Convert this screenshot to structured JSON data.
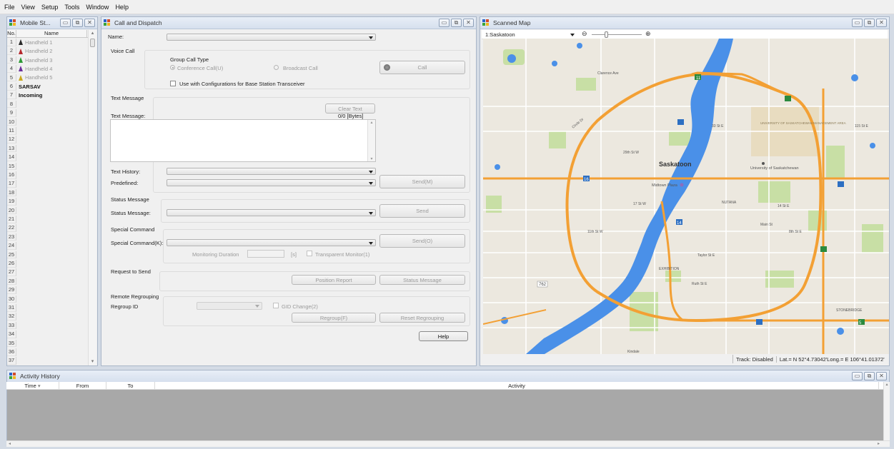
{
  "menu": [
    "File",
    "View",
    "Setup",
    "Tools",
    "Window",
    "Help"
  ],
  "mobile_stations": {
    "title": "Mobile St...",
    "col_no": "No.",
    "col_name": "Name",
    "rows": [
      {
        "no": "1",
        "name": "Handheld 1",
        "icon_color": "#2b2b2b",
        "bold": false
      },
      {
        "no": "2",
        "name": "Handheld 2",
        "icon_color": "#b5282d",
        "bold": false
      },
      {
        "no": "3",
        "name": "Handheld 3",
        "icon_color": "#2b9a34",
        "bold": false
      },
      {
        "no": "4",
        "name": "Handheld 4",
        "icon_color": "#6b2f9a",
        "bold": false
      },
      {
        "no": "5",
        "name": "Handheld 5",
        "icon_color": "#c9a81e",
        "bold": false
      },
      {
        "no": "6",
        "name": "SARSAV",
        "icon_color": "",
        "bold": true
      },
      {
        "no": "7",
        "name": "Incoming",
        "icon_color": "",
        "bold": true
      },
      {
        "no": "8",
        "name": ""
      },
      {
        "no": "9",
        "name": ""
      },
      {
        "no": "10",
        "name": ""
      },
      {
        "no": "11",
        "name": ""
      },
      {
        "no": "12",
        "name": ""
      },
      {
        "no": "13",
        "name": ""
      },
      {
        "no": "14",
        "name": ""
      },
      {
        "no": "15",
        "name": ""
      },
      {
        "no": "16",
        "name": ""
      },
      {
        "no": "17",
        "name": ""
      },
      {
        "no": "18",
        "name": ""
      },
      {
        "no": "19",
        "name": ""
      },
      {
        "no": "20",
        "name": ""
      },
      {
        "no": "21",
        "name": ""
      },
      {
        "no": "22",
        "name": ""
      },
      {
        "no": "23",
        "name": ""
      },
      {
        "no": "24",
        "name": ""
      },
      {
        "no": "25",
        "name": ""
      },
      {
        "no": "26",
        "name": ""
      },
      {
        "no": "27",
        "name": ""
      },
      {
        "no": "28",
        "name": ""
      },
      {
        "no": "29",
        "name": ""
      },
      {
        "no": "30",
        "name": ""
      },
      {
        "no": "31",
        "name": ""
      },
      {
        "no": "32",
        "name": ""
      },
      {
        "no": "33",
        "name": ""
      },
      {
        "no": "34",
        "name": ""
      },
      {
        "no": "35",
        "name": ""
      },
      {
        "no": "36",
        "name": ""
      },
      {
        "no": "37",
        "name": ""
      }
    ]
  },
  "call_dispatch": {
    "title": "Call and Dispatch",
    "name_label": "Name:",
    "voice_call": {
      "heading": "Voice Call",
      "group_call_type": "Group Call Type",
      "conference": "Conference Call(U)",
      "broadcast": "Broadcast Call",
      "call_button": "Call",
      "use_with_bst": "Use with Configurations for Base Station Transceiver"
    },
    "text_message": {
      "heading": "Text Message",
      "clear_button": "Clear Text",
      "label": "Text Message:",
      "bytes": "0/0 [Bytes]",
      "history_label": "Text History:",
      "predefined_label": "Predefined:",
      "send_button": "Send(M)"
    },
    "status_message": {
      "heading": "Status Message",
      "label": "Status Message:",
      "send_button": "Send"
    },
    "special_command": {
      "heading": "Special Command",
      "label": "Special Command(K):",
      "send_button": "Send(O)",
      "monitoring_label": "Monitoring Duration",
      "unit": "[s]",
      "transparent_label": "Transparent Monitor(1)"
    },
    "request_to_send": {
      "heading": "Request to Send",
      "position_button": "Position Report",
      "status_button": "Status Message"
    },
    "remote_regrouping": {
      "heading": "Remote Regrouping",
      "regroup_id_label": "Regroup ID",
      "gid_change": "GID Change(2)",
      "regroup_button": "Regroup(F)",
      "reset_button": "Reset Regrouping"
    },
    "help_button": "Help"
  },
  "scanned_map": {
    "title": "Scanned Map",
    "map_select": "1:Saskatoon",
    "labels": {
      "city": "Saskatoon",
      "university": "University of\nSaskatchewan",
      "univ_area": "UNIVERSITY OF\nSASKATCHEWAN\nMANAGEMENT\nAREA",
      "midtown": "Midtown Plaza",
      "nutana": "NUTANA",
      "exhibition": "EXHIBITION",
      "stonebridge": "STONEBRIDGE",
      "kindale": "Kindale",
      "taylor": "Taylor St E",
      "ruth": "Ruth St E",
      "st8": "8th St E",
      "st14": "14 St E",
      "main": "Main St",
      "r11": "11th St W",
      "r33": "33 St E",
      "r115": "115 St E",
      "r29": "29th St W",
      "r17": "17 St W",
      "hwy11": "11",
      "hwy16": "16",
      "hwy14": "14",
      "hwy762": "762",
      "hwy5": "5",
      "clarence": "Clarence Ave",
      "circle": "Circle Dr"
    },
    "status_track": "Track: Disabled",
    "status_coords": "Lat.= N 52°4.73042'Long.= E 106°41.01372'"
  },
  "activity": {
    "title": "Activity History",
    "cols": [
      "Time",
      "From",
      "To",
      "Activity"
    ]
  },
  "colors": {
    "road_major": "#f3a034",
    "river": "#4a90e8",
    "land": "#ece8df",
    "park": "#c8dfa5"
  }
}
